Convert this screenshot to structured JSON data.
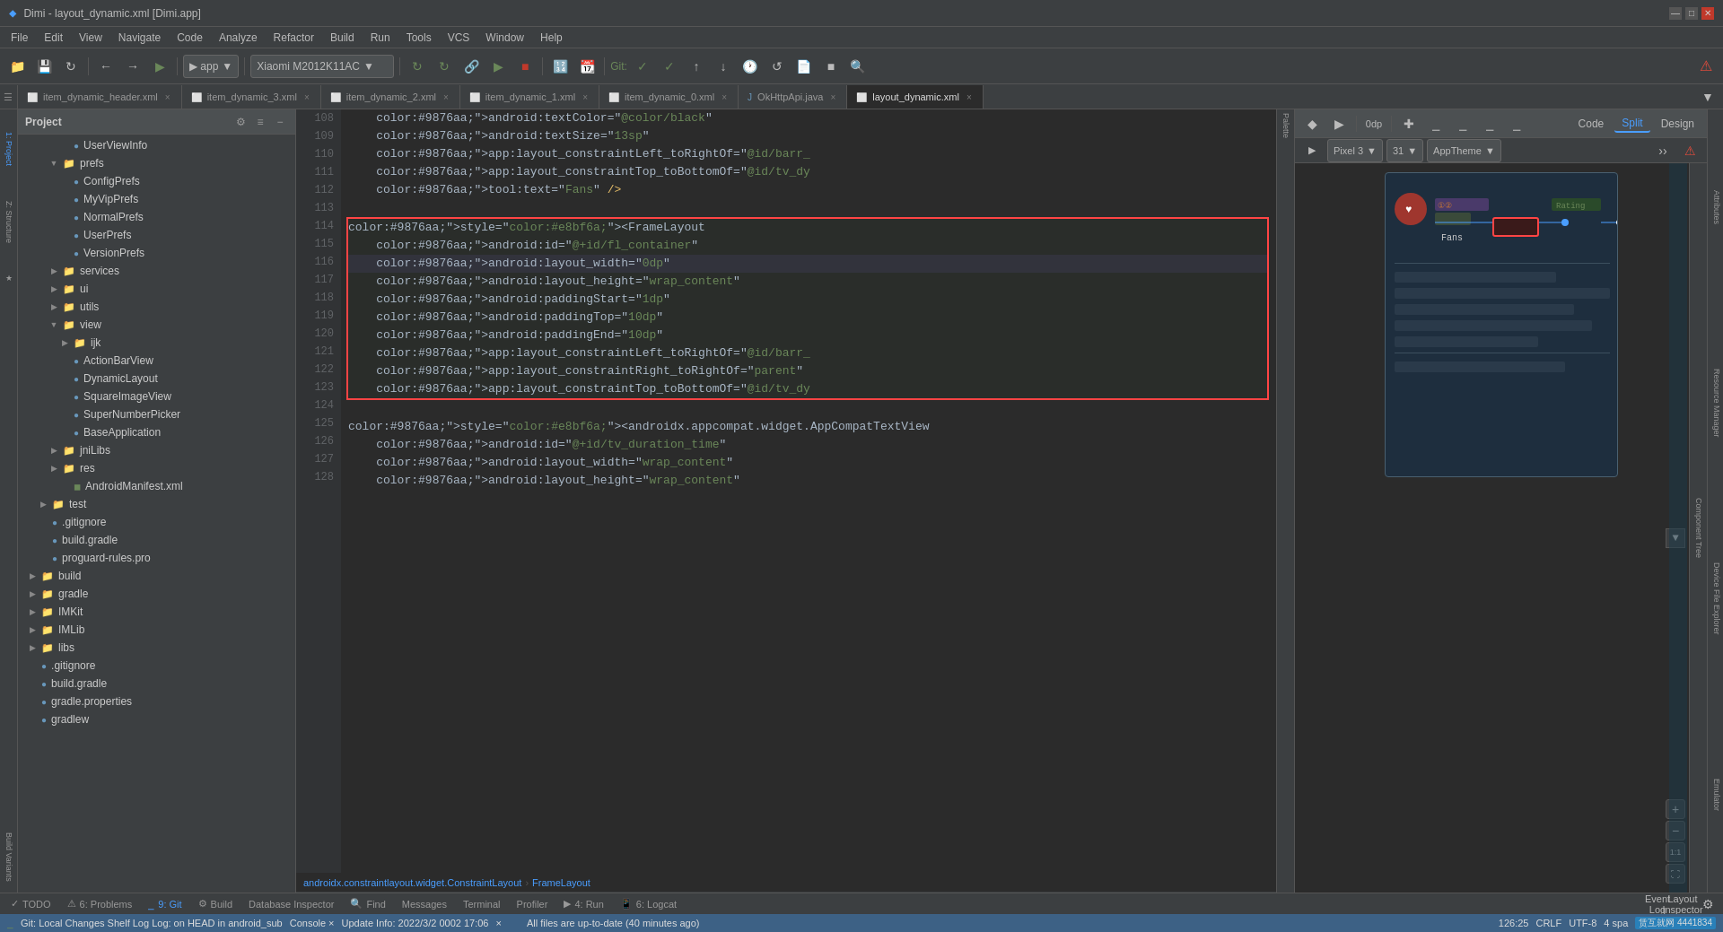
{
  "titleBar": {
    "title": "Dimi - layout_dynamic.xml [Dimi.app]",
    "minimize": "—",
    "maximize": "□",
    "close": "✕"
  },
  "menuBar": {
    "items": [
      "File",
      "Edit",
      "View",
      "Navigate",
      "Code",
      "Analyze",
      "Refactor",
      "Build",
      "Run",
      "Tools",
      "VCS",
      "Window",
      "Help"
    ]
  },
  "toolbar": {
    "appDropdown": "app",
    "deviceDropdown": "Xiaomi M2012K11AC",
    "gitLabel": "Git:",
    "apiLevel": "31"
  },
  "tabs": [
    {
      "label": "item_dynamic_header.xml",
      "active": false
    },
    {
      "label": "item_dynamic_3.xml",
      "active": false
    },
    {
      "label": "item_dynamic_2.xml",
      "active": false
    },
    {
      "label": "item_dynamic_1.xml",
      "active": false
    },
    {
      "label": "item_dynamic_0.xml",
      "active": false
    },
    {
      "label": "OkHttpApi.java",
      "active": false
    },
    {
      "label": "layout_dynamic.xml",
      "active": true
    }
  ],
  "projectPanel": {
    "title": "Project",
    "tree": [
      {
        "indent": 3,
        "type": "file",
        "label": "UserViewInfo",
        "arrow": ""
      },
      {
        "indent": 2,
        "type": "folder",
        "label": "prefs",
        "arrow": "▼"
      },
      {
        "indent": 3,
        "type": "file",
        "label": "ConfigPrefs",
        "arrow": ""
      },
      {
        "indent": 3,
        "type": "file",
        "label": "MyVipPrefs",
        "arrow": ""
      },
      {
        "indent": 3,
        "type": "file",
        "label": "NormalPrefs",
        "arrow": ""
      },
      {
        "indent": 3,
        "type": "file",
        "label": "UserPrefs",
        "arrow": ""
      },
      {
        "indent": 3,
        "type": "file",
        "label": "VersionPrefs",
        "arrow": ""
      },
      {
        "indent": 2,
        "type": "folder",
        "label": "services",
        "arrow": "▶"
      },
      {
        "indent": 2,
        "type": "folder",
        "label": "ui",
        "arrow": "▶"
      },
      {
        "indent": 2,
        "type": "folder",
        "label": "utils",
        "arrow": "▶"
      },
      {
        "indent": 2,
        "type": "folder",
        "label": "view",
        "arrow": "▼"
      },
      {
        "indent": 3,
        "type": "folder",
        "label": "ijk",
        "arrow": "▶"
      },
      {
        "indent": 3,
        "type": "file",
        "label": "ActionBarView",
        "arrow": ""
      },
      {
        "indent": 3,
        "type": "file",
        "label": "DynamicLayout",
        "arrow": ""
      },
      {
        "indent": 3,
        "type": "file",
        "label": "SquareImageView",
        "arrow": ""
      },
      {
        "indent": 3,
        "type": "file",
        "label": "SuperNumberPicker",
        "arrow": ""
      },
      {
        "indent": 3,
        "type": "file",
        "label": "BaseApplication",
        "arrow": ""
      },
      {
        "indent": 2,
        "type": "folder",
        "label": "jniLibs",
        "arrow": "▶"
      },
      {
        "indent": 2,
        "type": "folder",
        "label": "res",
        "arrow": "▶"
      },
      {
        "indent": 3,
        "type": "file",
        "label": "AndroidManifest.xml",
        "arrow": ""
      },
      {
        "indent": 1,
        "type": "folder",
        "label": "test",
        "arrow": "▶"
      },
      {
        "indent": 1,
        "type": "file",
        "label": ".gitignore",
        "arrow": ""
      },
      {
        "indent": 1,
        "type": "file",
        "label": "build.gradle",
        "arrow": ""
      },
      {
        "indent": 1,
        "type": "file",
        "label": "proguard-rules.pro",
        "arrow": ""
      },
      {
        "indent": 0,
        "type": "folder",
        "label": "build",
        "arrow": "▶"
      },
      {
        "indent": 0,
        "type": "folder",
        "label": "gradle",
        "arrow": "▶"
      },
      {
        "indent": 0,
        "type": "folder",
        "label": "IMKit",
        "arrow": "▶"
      },
      {
        "indent": 0,
        "type": "folder",
        "label": "IMLib",
        "arrow": "▶"
      },
      {
        "indent": 0,
        "type": "folder",
        "label": "libs",
        "arrow": "▶"
      },
      {
        "indent": 0,
        "type": "file",
        "label": ".gitignore",
        "arrow": ""
      },
      {
        "indent": 0,
        "type": "file",
        "label": "build.gradle",
        "arrow": ""
      },
      {
        "indent": 0,
        "type": "file",
        "label": "gradle.properties",
        "arrow": ""
      },
      {
        "indent": 0,
        "type": "file",
        "label": "gradlew",
        "arrow": ""
      }
    ]
  },
  "codeLines": [
    {
      "num": 108,
      "code": "    android:textColor=\"@color/black\"",
      "highlight": false,
      "selected": false
    },
    {
      "num": 109,
      "code": "    android:textSize=\"13sp\"",
      "highlight": false,
      "selected": false
    },
    {
      "num": 110,
      "code": "    app:layout_constraintLeft_toRightOf=\"@id/barr_",
      "highlight": false,
      "selected": false
    },
    {
      "num": 111,
      "code": "    app:layout_constraintTop_toBottomOf=\"@id/tv_dy",
      "highlight": false,
      "selected": false
    },
    {
      "num": 112,
      "code": "    tool:text=\"Fans\" />",
      "highlight": false,
      "selected": false
    },
    {
      "num": 113,
      "code": "",
      "highlight": false,
      "selected": false
    },
    {
      "num": 114,
      "code": "<FrameLayout",
      "highlight": true,
      "boxStart": true,
      "selected": false
    },
    {
      "num": 115,
      "code": "    android:id=\"@+id/fl_container\"",
      "highlight": true,
      "selected": false
    },
    {
      "num": 116,
      "code": "    android:layout_width=\"0dp\"",
      "highlight": true,
      "selected": true
    },
    {
      "num": 117,
      "code": "    android:layout_height=\"wrap_content\"",
      "highlight": true,
      "selected": false
    },
    {
      "num": 118,
      "code": "    android:paddingStart=\"1dp\"",
      "highlight": true,
      "selected": false
    },
    {
      "num": 119,
      "code": "    android:paddingTop=\"10dp\"",
      "highlight": true,
      "selected": false
    },
    {
      "num": 120,
      "code": "    android:paddingEnd=\"10dp\"",
      "highlight": true,
      "selected": false
    },
    {
      "num": 121,
      "code": "    app:layout_constraintLeft_toRightOf=\"@id/barr_",
      "highlight": true,
      "selected": false
    },
    {
      "num": 122,
      "code": "    app:layout_constraintRight_toRightOf=\"parent\"",
      "highlight": true,
      "selected": false
    },
    {
      "num": 123,
      "code": "    app:layout_constraintTop_toBottomOf=\"@id/tv_dy",
      "highlight": true,
      "boxEnd": true,
      "selected": false
    },
    {
      "num": 124,
      "code": "",
      "highlight": false,
      "selected": false
    },
    {
      "num": 125,
      "code": "<androidx.appcompat.widget.AppCompatTextView",
      "highlight": false,
      "selected": false
    },
    {
      "num": 126,
      "code": "    android:id=\"@+id/tv_duration_time\"",
      "highlight": false,
      "selected": false
    },
    {
      "num": 127,
      "code": "    android:layout_width=\"wrap_content\"",
      "highlight": false,
      "selected": false
    },
    {
      "num": 128,
      "code": "    android:layout_height=\"wrap_content\"",
      "highlight": false,
      "selected": false
    }
  ],
  "breadcrumb": {
    "items": [
      "androidx.constraintlayout.widget.ConstraintLayout",
      "FrameLayout"
    ]
  },
  "bottomTabs": [
    {
      "label": "TODO",
      "icon": "✓",
      "active": false
    },
    {
      "label": "6: Problems",
      "icon": "!",
      "active": false
    },
    {
      "label": "9: Git",
      "icon": "⎇",
      "active": true
    },
    {
      "label": "Build",
      "icon": "⚙",
      "active": false
    },
    {
      "label": "Database Inspector",
      "icon": "🗄",
      "active": false
    },
    {
      "label": "Find",
      "icon": "🔍",
      "active": false
    },
    {
      "label": "Messages",
      "icon": "✉",
      "active": false
    },
    {
      "label": "Terminal",
      "icon": ">_",
      "active": false
    },
    {
      "label": "Profiler",
      "icon": "📊",
      "active": false
    },
    {
      "label": "4: Run",
      "icon": "▶",
      "active": false
    },
    {
      "label": "6: Logcat",
      "icon": "📱",
      "active": false
    }
  ],
  "statusBar": {
    "gitBranch": "Git:  Local Changes  Shelf  Log  Log: on HEAD in android_sub ×  Console ×  Update Info: 2022/3/2 0002 17:06 ×",
    "position": "126:25",
    "encoding": "UTF-8",
    "lineSep": "CRLF",
    "indent": "4 spa",
    "rightInfo": "All files are up-to-date (40 minutes ago)"
  },
  "designView": {
    "tabs": [
      "Code",
      "Split",
      "Design"
    ],
    "activeTab": "Split",
    "device": "Pixel 3",
    "apiLevel": "31",
    "theme": "AppTheme"
  },
  "colors": {
    "accent": "#4a9eff",
    "highlight": "#214283",
    "boxBorder": "#ff4444",
    "selectedLine": "#32333c",
    "folderColor": "#e8bf6a",
    "fileColor": "#6897bb",
    "tagColor": "#e8bf6a",
    "attrColor": "#9876aa",
    "valueColor": "#6a8759",
    "keywordColor": "#cc7832"
  }
}
